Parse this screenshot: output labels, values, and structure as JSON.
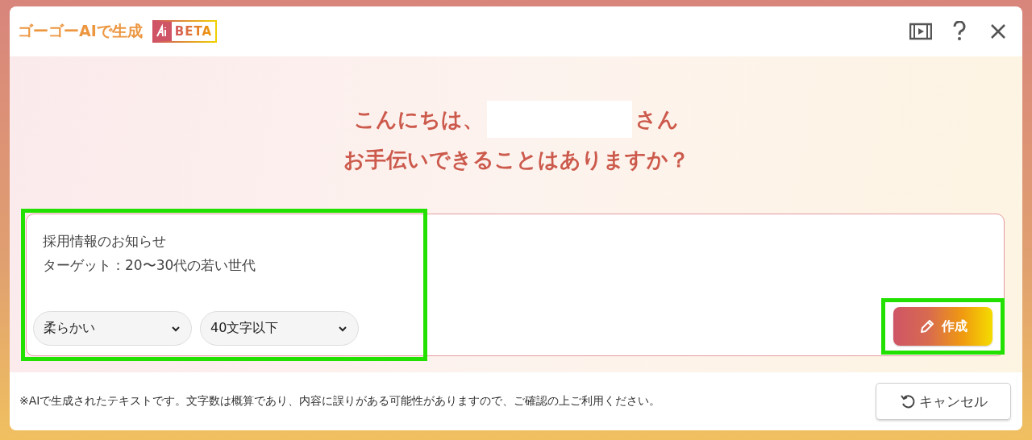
{
  "dialog": {
    "title": "ゴーゴーAIで生成",
    "badge": "BETA"
  },
  "greeting": {
    "before": "こんにちは、",
    "name_hidden": true,
    "after": "さん",
    "question": "お手伝いできることはありますか？"
  },
  "prompt": {
    "lines": [
      "採用情報のお知らせ",
      "ターゲット：20〜30代の若い世代"
    ],
    "highlighted": true,
    "selects": [
      {
        "value": "柔らかい"
      },
      {
        "value": "40文字以下"
      }
    ]
  },
  "create_button": {
    "label": "作成",
    "highlighted": true
  },
  "footer": {
    "note": "※AIで生成されたテキストです。文字数は概算であり、内容に誤りがある可能性がありますので、ご確認の上ご利用ください。",
    "cancel": "キャンセル"
  }
}
